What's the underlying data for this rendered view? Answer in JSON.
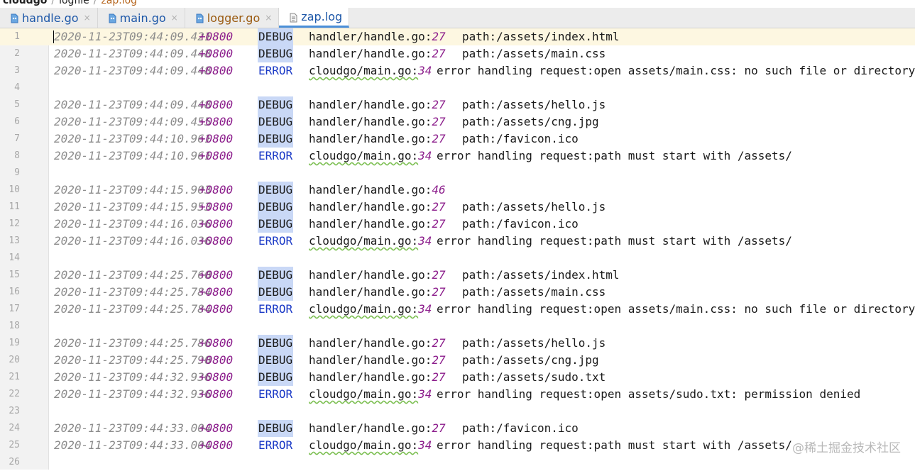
{
  "breadcrumb": {
    "root": "cloudgo",
    "sep1": "/",
    "middle": "logfile",
    "sep2": "/",
    "current": "zap.log"
  },
  "tabs": [
    {
      "label": "handle.go",
      "close": "×",
      "icon": "go-file-icon"
    },
    {
      "label": "main.go",
      "close": "×",
      "icon": "go-file-icon"
    },
    {
      "label": "logger.go",
      "close": "×",
      "icon": "go-file-icon"
    },
    {
      "label": "zap.log",
      "close": "×",
      "icon": "log-file-icon"
    }
  ],
  "log_lines": [
    {
      "n": "1",
      "ts": "2020-11-23T09:44:09.421",
      "tz": "+0800",
      "level": "DEBUG",
      "file": "handler/handle.go:",
      "line": "27",
      "msg": "path:/assets/index.html"
    },
    {
      "n": "2",
      "ts": "2020-11-23T09:44:09.448",
      "tz": "+0800",
      "level": "DEBUG",
      "file": "handler/handle.go:",
      "line": "27",
      "msg": "path:/assets/main.css"
    },
    {
      "n": "3",
      "ts": "2020-11-23T09:44:09.448",
      "tz": "+0800",
      "level": "ERROR",
      "file": "cloudgo/main.go:",
      "line": "34",
      "msg": "error handling request:open assets/main.css: no such file or directory"
    },
    {
      "n": "4"
    },
    {
      "n": "5",
      "ts": "2020-11-23T09:44:09.448",
      "tz": "+0800",
      "level": "DEBUG",
      "file": "handler/handle.go:",
      "line": "27",
      "msg": "path:/assets/hello.js"
    },
    {
      "n": "6",
      "ts": "2020-11-23T09:44:09.455",
      "tz": "+0800",
      "level": "DEBUG",
      "file": "handler/handle.go:",
      "line": "27",
      "msg": "path:/assets/cng.jpg"
    },
    {
      "n": "7",
      "ts": "2020-11-23T09:44:10.961",
      "tz": "+0800",
      "level": "DEBUG",
      "file": "handler/handle.go:",
      "line": "27",
      "msg": "path:/favicon.ico"
    },
    {
      "n": "8",
      "ts": "2020-11-23T09:44:10.961",
      "tz": "+0800",
      "level": "ERROR",
      "file": "cloudgo/main.go:",
      "line": "34",
      "msg": "error handling request:path must start with /assets/"
    },
    {
      "n": "9"
    },
    {
      "n": "10",
      "ts": "2020-11-23T09:44:15.903",
      "tz": "+0800",
      "level": "DEBUG",
      "file": "handler/handle.go:",
      "line": "46",
      "msg": ""
    },
    {
      "n": "11",
      "ts": "2020-11-23T09:44:15.953",
      "tz": "+0800",
      "level": "DEBUG",
      "file": "handler/handle.go:",
      "line": "27",
      "msg": "path:/assets/hello.js"
    },
    {
      "n": "12",
      "ts": "2020-11-23T09:44:16.036",
      "tz": "+0800",
      "level": "DEBUG",
      "file": "handler/handle.go:",
      "line": "27",
      "msg": "path:/favicon.ico"
    },
    {
      "n": "13",
      "ts": "2020-11-23T09:44:16.036",
      "tz": "+0800",
      "level": "ERROR",
      "file": "cloudgo/main.go:",
      "line": "34",
      "msg": "error handling request:path must start with /assets/"
    },
    {
      "n": "14"
    },
    {
      "n": "15",
      "ts": "2020-11-23T09:44:25.760",
      "tz": "+0800",
      "level": "DEBUG",
      "file": "handler/handle.go:",
      "line": "27",
      "msg": "path:/assets/index.html"
    },
    {
      "n": "16",
      "ts": "2020-11-23T09:44:25.784",
      "tz": "+0800",
      "level": "DEBUG",
      "file": "handler/handle.go:",
      "line": "27",
      "msg": "path:/assets/main.css"
    },
    {
      "n": "17",
      "ts": "2020-11-23T09:44:25.784",
      "tz": "+0800",
      "level": "ERROR",
      "file": "cloudgo/main.go:",
      "line": "34",
      "msg": "error handling request:open assets/main.css: no such file or directory"
    },
    {
      "n": "18"
    },
    {
      "n": "19",
      "ts": "2020-11-23T09:44:25.786",
      "tz": "+0800",
      "level": "DEBUG",
      "file": "handler/handle.go:",
      "line": "27",
      "msg": "path:/assets/hello.js"
    },
    {
      "n": "20",
      "ts": "2020-11-23T09:44:25.790",
      "tz": "+0800",
      "level": "DEBUG",
      "file": "handler/handle.go:",
      "line": "27",
      "msg": "path:/assets/cng.jpg"
    },
    {
      "n": "21",
      "ts": "2020-11-23T09:44:32.936",
      "tz": "+0800",
      "level": "DEBUG",
      "file": "handler/handle.go:",
      "line": "27",
      "msg": "path:/assets/sudo.txt"
    },
    {
      "n": "22",
      "ts": "2020-11-23T09:44:32.936",
      "tz": "+0800",
      "level": "ERROR",
      "file": "cloudgo/main.go:",
      "line": "34",
      "msg": "error handling request:open assets/sudo.txt: permission denied"
    },
    {
      "n": "23"
    },
    {
      "n": "24",
      "ts": "2020-11-23T09:44:33.004",
      "tz": "+0800",
      "level": "DEBUG",
      "file": "handler/handle.go:",
      "line": "27",
      "msg": "path:/favicon.ico"
    },
    {
      "n": "25",
      "ts": "2020-11-23T09:44:33.004",
      "tz": "+0800",
      "level": "ERROR",
      "file": "cloudgo/main.go:",
      "line": "34",
      "msg": "error handling request:path must start with /assets/"
    },
    {
      "n": "26"
    }
  ],
  "watermark": "@稀土掘金技术社区",
  "colors": {
    "debug_highlight": "#c9d8f6",
    "error_level": "#1a39c6",
    "line_number_purple": "#8b1c8b",
    "timestamp_gray": "#8c8c8c",
    "active_tab_underline": "#4a8fd8",
    "current_line_bg": "#fdf7e1"
  }
}
